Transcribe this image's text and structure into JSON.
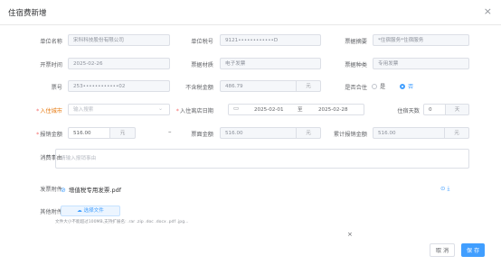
{
  "dialog": {
    "title": "住宿费新增",
    "close_icon": "×"
  },
  "row1": {
    "unit_label": "单位名称",
    "unit_value": "宋科科技股份有限公司",
    "tax_label": "单位税号",
    "tax_value": "9121••••••••••••D",
    "project_label": "票据摘要",
    "project_value": "*住宿服务*住宿服务"
  },
  "row2": {
    "date_label": "开票时间",
    "date_value": "2025-02-26",
    "material_label": "票据材质",
    "material_value": "电子发票",
    "kind_label": "票据种类",
    "kind_value": "专用发票"
  },
  "row3": {
    "code_label": "票号",
    "code_value": "253••••••••••••02",
    "notax_label": "不含税金额",
    "notax_value": "486.79",
    "notax_unit": "元",
    "combine_label": "是否合住",
    "opt_yes": "是",
    "opt_no": "否"
  },
  "row4": {
    "city_label": "入住城市",
    "city_placeholder": "输入搜索",
    "stay_label": "入住离店日期",
    "start": "2025-02-01",
    "to": "至",
    "end": "2025-02-28",
    "days_label": "住宿天数",
    "days_value": "0",
    "days_unit": "天"
  },
  "row5": {
    "reimb_label": "报销金额",
    "reimb_value": "516.00",
    "reimb_unit": "元",
    "dash": "–",
    "invoice_amt_label": "票面金额",
    "invoice_amt_value": "516.00",
    "invoice_amt_unit": "元",
    "total_label": "累计报销金额",
    "total_value": "516.00",
    "total_unit": "元"
  },
  "reason": {
    "label": "消费事由",
    "placeholder": "请输入报销事由"
  },
  "attach": {
    "label": "发票附件",
    "filename": "增值税专用发票.pdf",
    "icons": "⊙ ⤓"
  },
  "other": {
    "label": "其他附件",
    "button": "选择文件",
    "hint": "文件大小不能超过100MB,支持扩展名: .rar .zip .doc .docx .pdf .jpg...",
    "close": "×"
  },
  "footer": {
    "cancel": "取 消",
    "save": "保 存"
  },
  "colors": {
    "primary": "#409eff",
    "required": "#f56c6c"
  }
}
